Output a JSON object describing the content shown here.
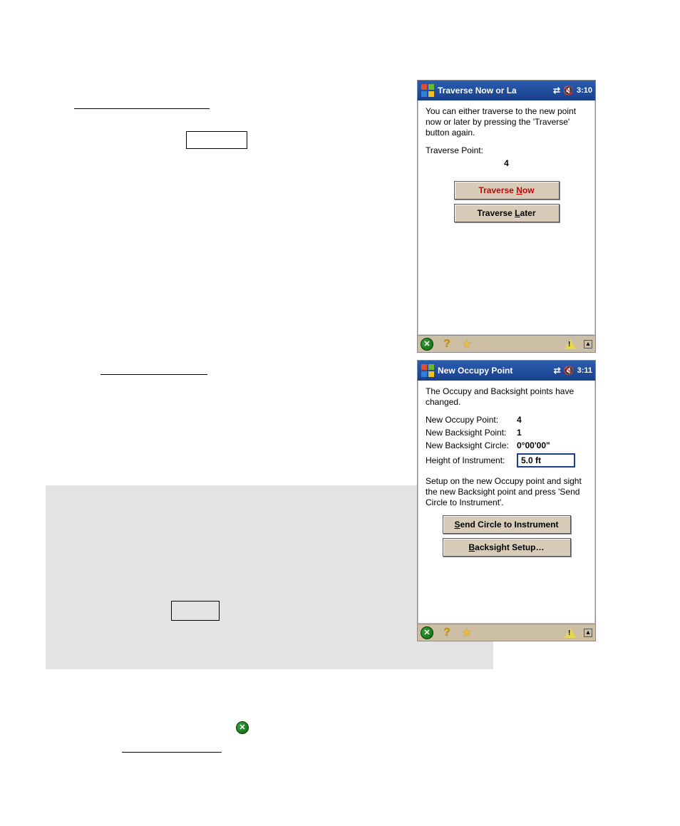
{
  "screenshot1": {
    "title": "Traverse Now or La",
    "time": "3:10",
    "intro": "You can either traverse to the new point now or later by pressing the 'Traverse' button again.",
    "point_label": "Traverse Point:",
    "point_value": "4",
    "btn_now_prefix": "Traverse ",
    "btn_now_ul": "N",
    "btn_now_suffix": "ow",
    "btn_later_prefix": "Traverse ",
    "btn_later_ul": "L",
    "btn_later_suffix": "ater"
  },
  "screenshot2": {
    "title": "New Occupy Point",
    "time": "3:11",
    "intro": "The Occupy and Backsight points have changed.",
    "row_occupy_label": "New Occupy Point:",
    "row_occupy_value": "4",
    "row_bs_label": "New Backsight Point:",
    "row_bs_value": "1",
    "row_circle_label": "New Backsight Circle:",
    "row_circle_value": "0°00'00\"",
    "row_hi_label": "Height of Instrument:",
    "row_hi_value": "5.0 ft",
    "instruction": "Setup on the new Occupy point and sight the new Backsight point and press 'Send Circle to Instrument'.",
    "btn_send_ul": "S",
    "btn_send_rest": "end Circle to Instrument",
    "btn_bs_ul": "B",
    "btn_bs_rest": "acksight Setup…"
  }
}
